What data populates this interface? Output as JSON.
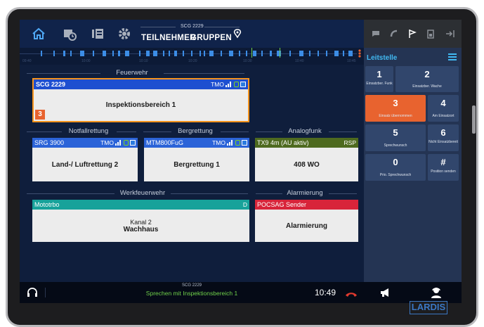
{
  "topbar": {
    "tabs": [
      "TEILNEHMER",
      "GRUPPEN"
    ],
    "current_group": "SCG 2229",
    "icons": [
      "home-icon",
      "calendar-clock-icon",
      "contacts-icon",
      "gear-icon",
      "location-pin-icon"
    ]
  },
  "timeline": {
    "labels": [
      "09:40",
      "10:00",
      "10:10",
      "10:20",
      "10:30",
      "10:40",
      "10:45"
    ]
  },
  "right_panel": {
    "title": "Leitstelle",
    "tabs": [
      "message-icon",
      "phone-icon",
      "flag-icon",
      "sim-icon",
      "logout-icon"
    ],
    "keys": [
      {
        "num": "1",
        "label": "Einsatzber. Funk",
        "active": false
      },
      {
        "num": "2",
        "label": "Einsatzber. Wache",
        "active": false
      },
      {
        "num": "3",
        "label": "Einsatz übernommen",
        "active": true
      },
      {
        "num": "4",
        "label": "Am Einsatzort",
        "active": false
      },
      {
        "num": "5",
        "label": "Sprechwunsch",
        "active": false
      },
      {
        "num": "6",
        "label": "Nicht Einsatzbereit",
        "active": false
      },
      {
        "num": "0",
        "label": "Prio. Sprechwunsch",
        "active": false
      },
      {
        "num": "#",
        "label": "Position senden",
        "active": false
      }
    ]
  },
  "sections": {
    "feuerwehr": "Feuerwehr",
    "notfallrettung": "Notfallrettung",
    "bergrettung": "Bergrettung",
    "analogfunk": "Analogfunk",
    "werkfeuerwehr": "Werkfeuerwehr",
    "alarmierung": "Alarmierung"
  },
  "cards": {
    "scg": {
      "name": "SCG 2229",
      "mode": "TMO",
      "body": "Inspektionsbereich 1",
      "badge": "3",
      "color": "#1e4fd0",
      "border": "#f7941d"
    },
    "srg": {
      "name": "SRG 3900",
      "mode": "TMO",
      "body": "Land-/ Luftrettung 2",
      "color": "#2b63d8"
    },
    "mtm": {
      "name": "MTM800FuG",
      "mode": "TMO",
      "body": "Bergrettung 1",
      "color": "#2b63d8"
    },
    "tx9": {
      "name": "TX9 4m (AU aktiv)",
      "mode": "RSP",
      "body": "408 WO",
      "color": "#4e6a1f"
    },
    "mototrbo": {
      "name": "Mototrbo",
      "mode": "D",
      "body_line1": "Kanal 2",
      "body_line2": "Wachhaus",
      "color": "#17a29a"
    },
    "pocsag": {
      "name": "POCSAG Sender",
      "body": "Alarmierung",
      "color": "#d8243a"
    }
  },
  "bottom": {
    "group": "SCG 2229",
    "message": "Sprechen mit Inspektionsbereich 1",
    "time": "10:49"
  },
  "brand": "LARDIS"
}
